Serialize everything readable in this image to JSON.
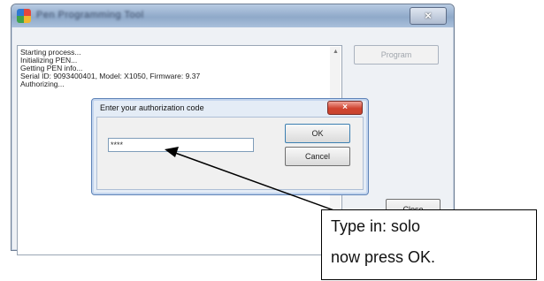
{
  "window": {
    "title": "Pen Programming Tool",
    "close_symbol": "×"
  },
  "log": {
    "lines": [
      "Starting process...",
      "Initializing PEN...",
      "Getting PEN info...",
      "Serial ID: 9093400401, Model: X1050, Firmware: 9.37",
      "Authorizing..."
    ]
  },
  "buttons": {
    "program": "Program",
    "close": "Close"
  },
  "dialog": {
    "title": "Enter your authorization code",
    "close_symbol": "×",
    "input_value": "****",
    "ok": "OK",
    "cancel": "Cancel"
  },
  "callout": {
    "line1": "Type in:  solo",
    "line2": "now press OK."
  },
  "colors": {
    "dialog_close": "#d0432f",
    "accent_border": "#5f84b8"
  }
}
